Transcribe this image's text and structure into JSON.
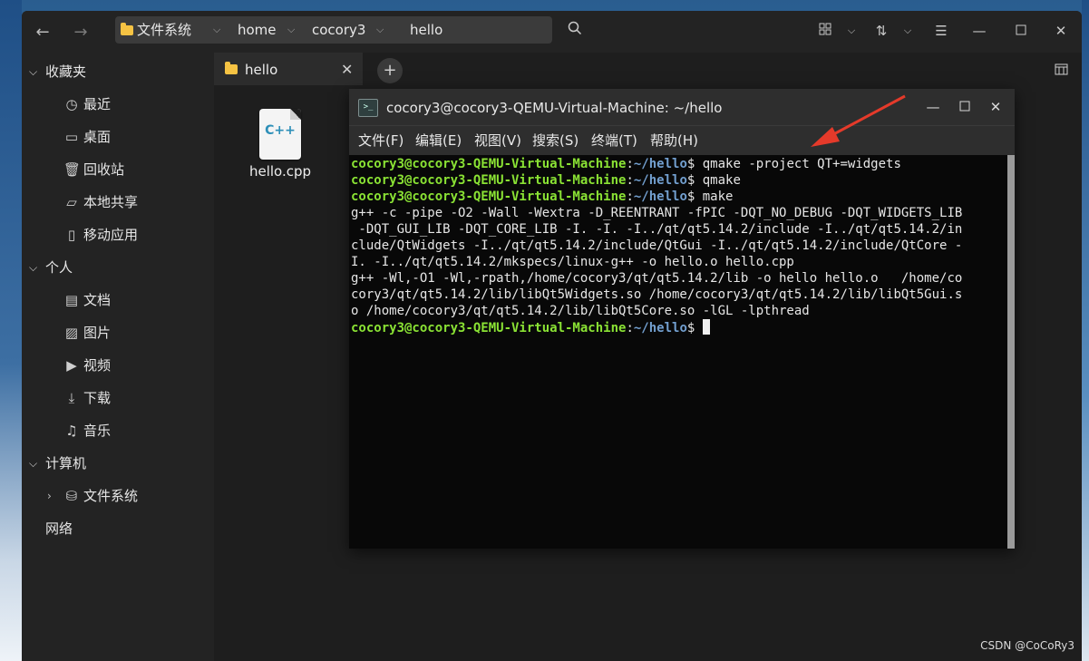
{
  "breadcrumb": {
    "items": [
      "文件系统",
      "home",
      "cocory3",
      "hello"
    ]
  },
  "sidebar": {
    "sections": [
      {
        "label": "收藏夹",
        "items": [
          "最近",
          "桌面",
          "回收站",
          "本地共享",
          "移动应用"
        ]
      },
      {
        "label": "个人",
        "items": [
          "文档",
          "图片",
          "视频",
          "下载",
          "音乐"
        ]
      },
      {
        "label": "计算机",
        "items": [
          "文件系统"
        ]
      },
      {
        "label": "网络",
        "items": []
      }
    ]
  },
  "tabs": [
    {
      "label": "hello"
    }
  ],
  "files": [
    {
      "name": "hello.cpp",
      "icon_text": "C++"
    }
  ],
  "terminal": {
    "title": "cocory3@cocory3-QEMU-Virtual-Machine: ~/hello",
    "menu": [
      "文件(F)",
      "编辑(E)",
      "视图(V)",
      "搜索(S)",
      "终端(T)",
      "帮助(H)"
    ],
    "prompt_user": "cocory3@cocory3-QEMU-Virtual-Machine",
    "prompt_sep": ":",
    "prompt_path": "~/hello",
    "prompt_symbol": "$",
    "lines": [
      {
        "type": "prompt",
        "cmd": " qmake -project QT+=widgets"
      },
      {
        "type": "prompt",
        "cmd": " qmake"
      },
      {
        "type": "prompt",
        "cmd": " make"
      },
      {
        "type": "out",
        "text": "g++ -c -pipe -O2 -Wall -Wextra -D_REENTRANT -fPIC -DQT_NO_DEBUG -DQT_WIDGETS_LIB"
      },
      {
        "type": "out",
        "text": " -DQT_GUI_LIB -DQT_CORE_LIB -I. -I. -I../qt/qt5.14.2/include -I../qt/qt5.14.2/in"
      },
      {
        "type": "out",
        "text": "clude/QtWidgets -I../qt/qt5.14.2/include/QtGui -I../qt/qt5.14.2/include/QtCore -"
      },
      {
        "type": "out",
        "text": "I. -I../qt/qt5.14.2/mkspecs/linux-g++ -o hello.o hello.cpp"
      },
      {
        "type": "out",
        "text": "g++ -Wl,-O1 -Wl,-rpath,/home/cocory3/qt/qt5.14.2/lib -o hello hello.o   /home/co"
      },
      {
        "type": "out",
        "text": "cory3/qt/qt5.14.2/lib/libQt5Widgets.so /home/cocory3/qt/qt5.14.2/lib/libQt5Gui.s"
      },
      {
        "type": "out",
        "text": "o /home/cocory3/qt/qt5.14.2/lib/libQt5Core.so -lGL -lpthread"
      },
      {
        "type": "prompt",
        "cmd": " ",
        "cursor": true
      }
    ]
  },
  "watermark": "CSDN @CoCoRy3",
  "colors": {
    "annotation_arrow": "#e53a2a",
    "prompt_user": "#8ae234",
    "prompt_path": "#729fcf"
  }
}
